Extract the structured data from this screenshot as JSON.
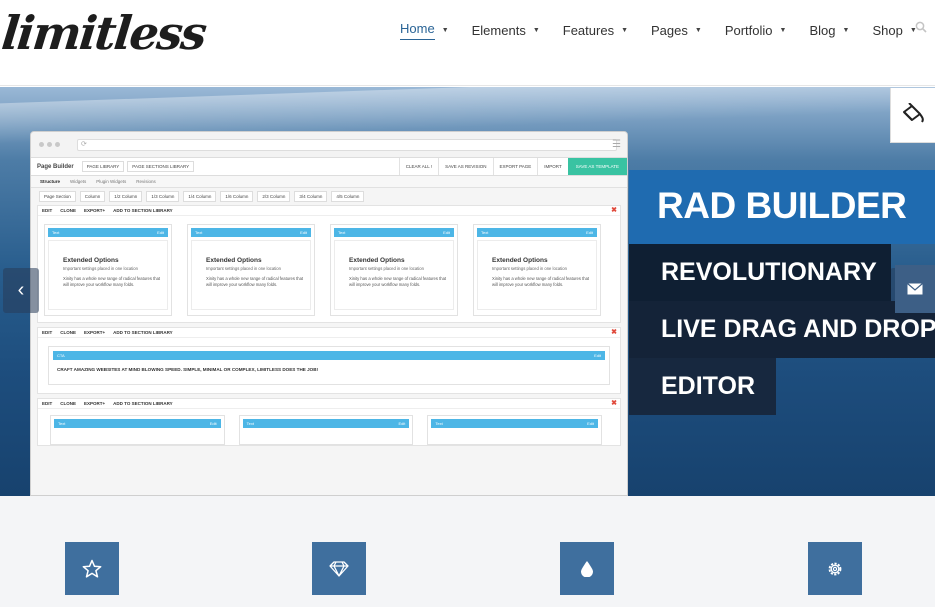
{
  "brand": {
    "logo_text": "limitless"
  },
  "nav": {
    "items": [
      {
        "label": "Home"
      },
      {
        "label": "Elements"
      },
      {
        "label": "Features"
      },
      {
        "label": "Pages"
      },
      {
        "label": "Portfolio"
      },
      {
        "label": "Blog"
      },
      {
        "label": "Shop"
      }
    ],
    "active_item": "Home",
    "caret_glyph": "▼"
  },
  "hero": {
    "headline": "RAD BUILDER",
    "lines": [
      "REVOLUTIONARY",
      "LIVE DRAG AND DROP",
      "EDITOR"
    ],
    "prev_glyph": "‹",
    "next_glyph": "›"
  },
  "builder_mock": {
    "title": "Page Builder",
    "left_buttons": [
      "PAGE LIBRARY",
      "PAGE SECTIONS LIBRARY"
    ],
    "right_buttons": [
      "CLEAR ALL !",
      "SAVE AS REVISION",
      "EXPORT PAGE",
      "IMPORT"
    ],
    "save_button": "SAVE AS TEMPLATE",
    "tabs": [
      "Structure",
      "Widgets",
      "Plugin Widgets",
      "Revisions"
    ],
    "columns": [
      "Page Section",
      "Column",
      "1/2 Column",
      "1/3 Column",
      "1/4 Column",
      "1/6 Column",
      "2/3 Column",
      "3/4 Column",
      "4/5 Column"
    ],
    "section_actions": [
      "EDIT",
      "CLONE",
      "EXPORT+",
      "ADD TO SECTION LIBRARY"
    ],
    "close_glyph": "✖",
    "widget": {
      "label": "Text",
      "edit": "Edit",
      "title": "Extended Options",
      "subtitle": "Important settings placed in one location",
      "text": "Xinity has a whole new range of radical features that will improve your workflow many folds."
    },
    "cta": {
      "label": "CTA",
      "edit": "Edit",
      "text": "CRAFT AMAZING WEBSITES AT MIND BLOWING SPEED. SIMPLE, MINIMAL OR COMPLEX, LIMITLESS DOES THE JOB!"
    }
  },
  "side_tabs": [
    {
      "icon": "paint-bucket-icon"
    },
    {
      "icon": "envelope-icon"
    }
  ],
  "features": [
    {
      "icon": "star-icon"
    },
    {
      "icon": "diamond-icon"
    },
    {
      "icon": "drop-icon"
    },
    {
      "icon": "gear-icon"
    }
  ],
  "colors": {
    "accent": "#1f6bb0",
    "nav_active": "#2a6496",
    "feature_box": "#3f6f9e",
    "dark_band": "#0f1f33",
    "save_green": "#39c3a2",
    "widget_blue": "#4db6e6"
  }
}
